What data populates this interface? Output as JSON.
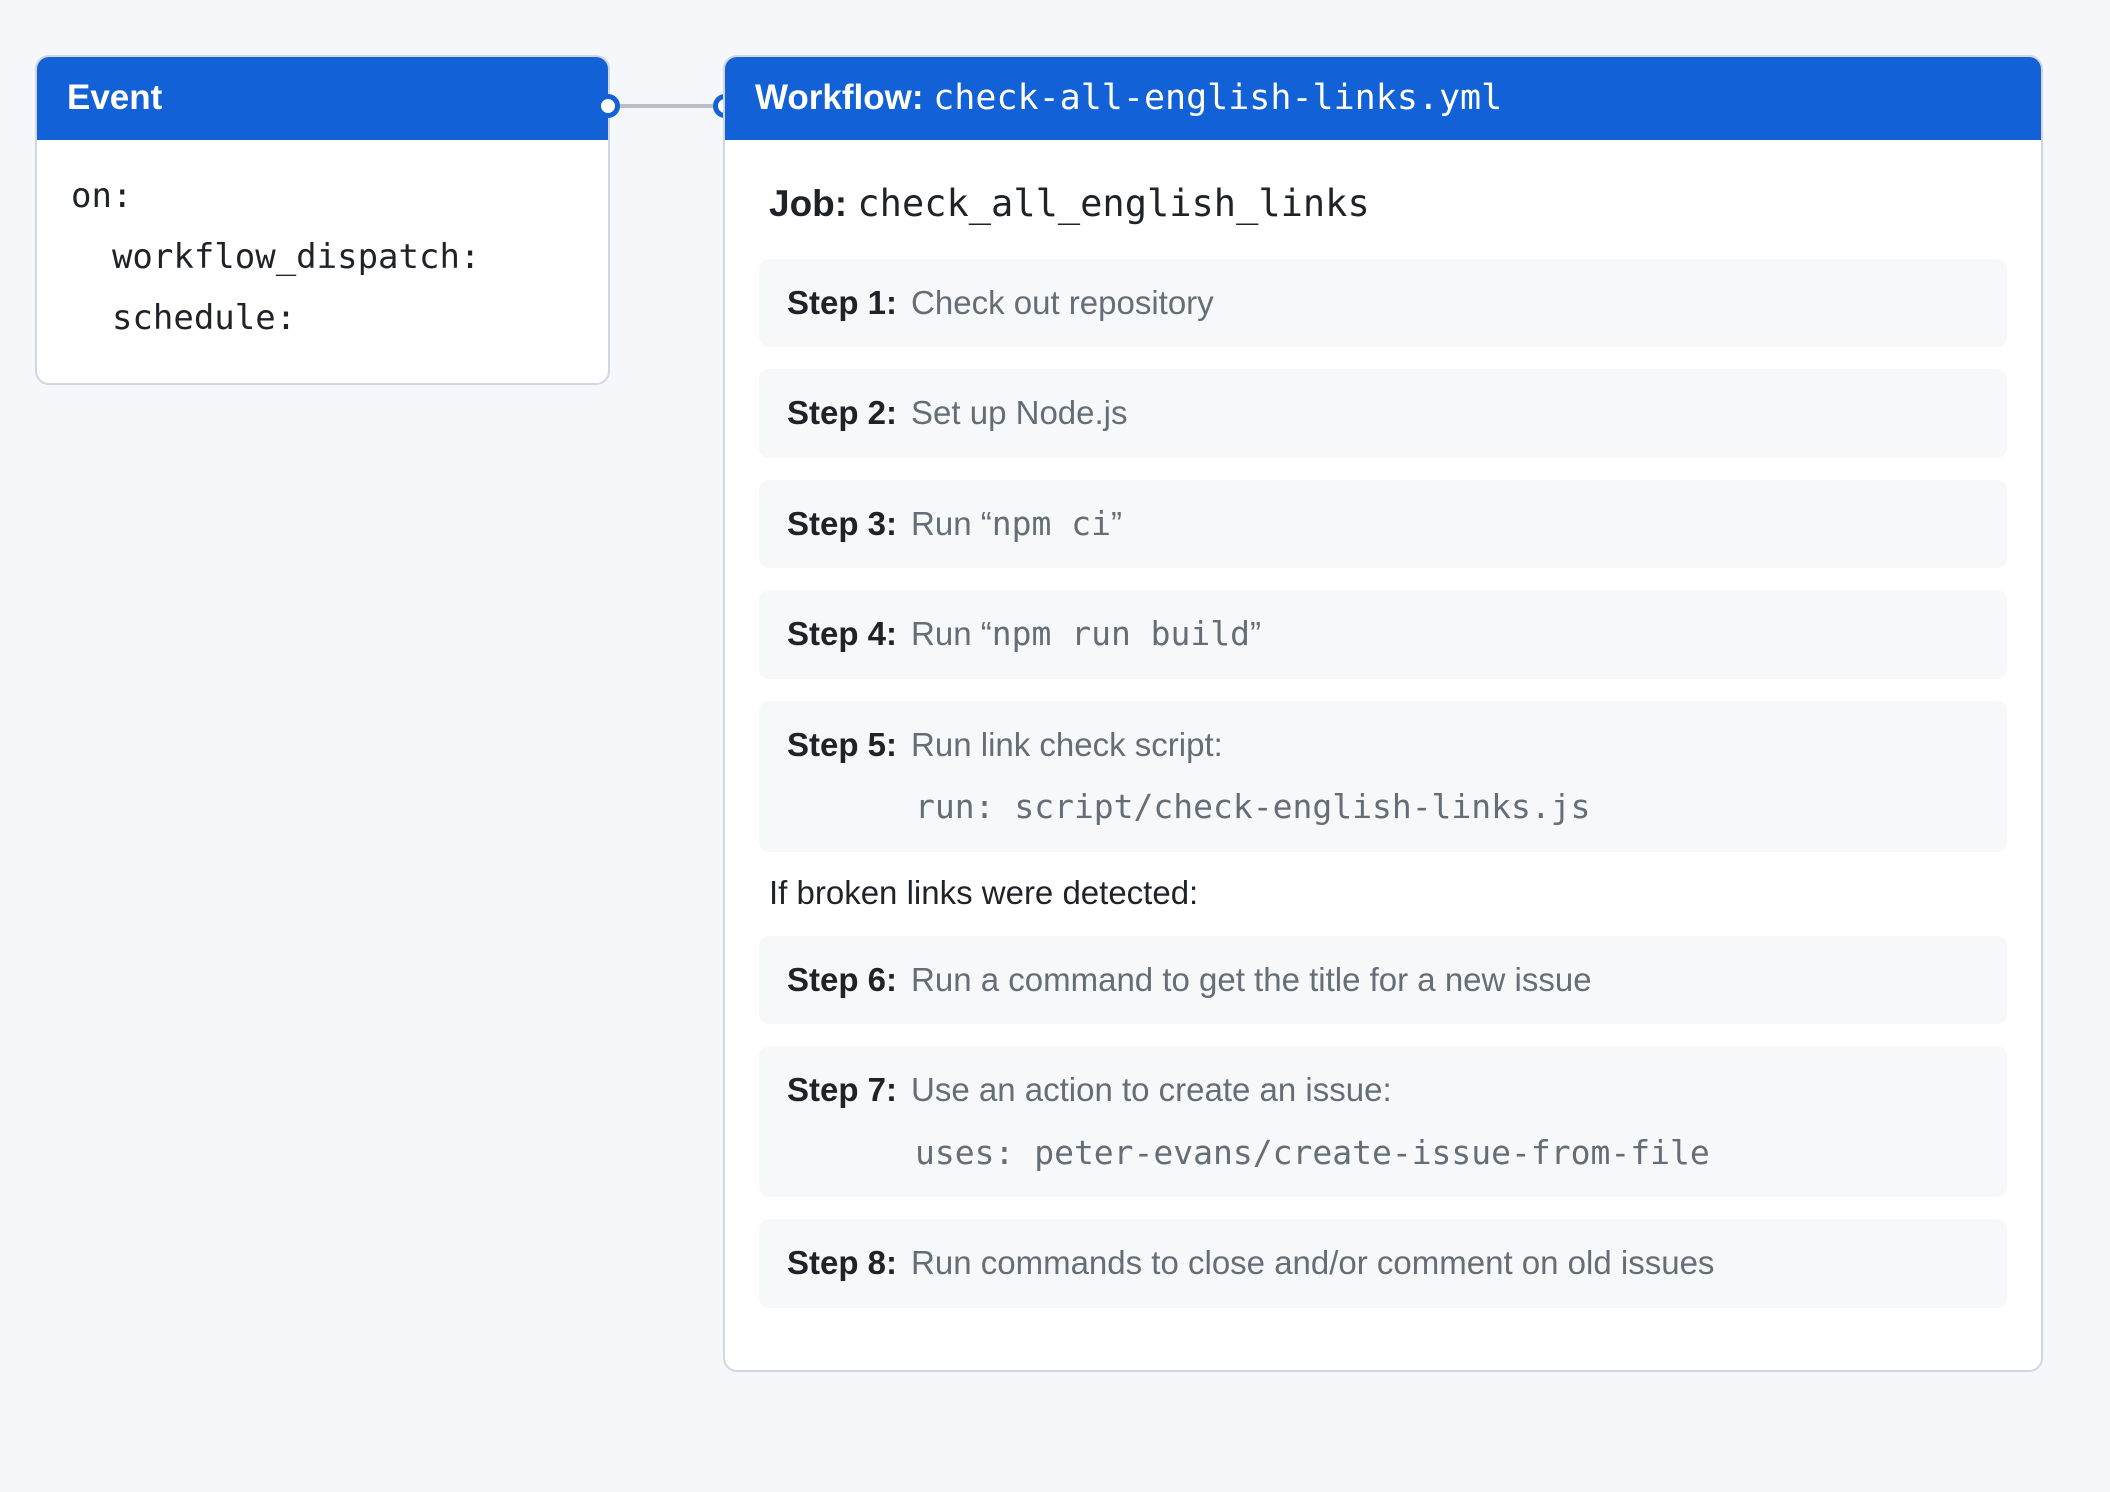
{
  "event": {
    "title": "Event",
    "body": "on:\n  workflow_dispatch:\n  schedule:"
  },
  "workflow": {
    "title_label": "Workflow: ",
    "title_file": "check-all-english-links.yml",
    "job_label": "Job: ",
    "job_name": "check_all_english_links",
    "steps_a": [
      {
        "label": "Step 1:",
        "desc_plain": "Check out repository"
      },
      {
        "label": "Step 2:",
        "desc_plain": "Set up Node.js"
      },
      {
        "label": "Step 3:",
        "desc_prefix": "Run “",
        "desc_mono": "npm ci",
        "desc_suffix": "”"
      },
      {
        "label": "Step 4:",
        "desc_prefix": "Run “",
        "desc_mono": "npm run build",
        "desc_suffix": "”"
      },
      {
        "label": "Step 5:",
        "desc_plain": "Run link check script:",
        "code": "run: script/check-english-links.js"
      }
    ],
    "note": "If broken links were detected:",
    "steps_b": [
      {
        "label": "Step 6:",
        "desc_plain": "Run a command to get the title for a new issue"
      },
      {
        "label": "Step 7:",
        "desc_plain": "Use an action to create an issue:",
        "code": "uses: peter-evans/create-issue-from-file"
      },
      {
        "label": "Step 8:",
        "desc_plain": "Run commands to close and/or comment on old issues"
      }
    ]
  }
}
